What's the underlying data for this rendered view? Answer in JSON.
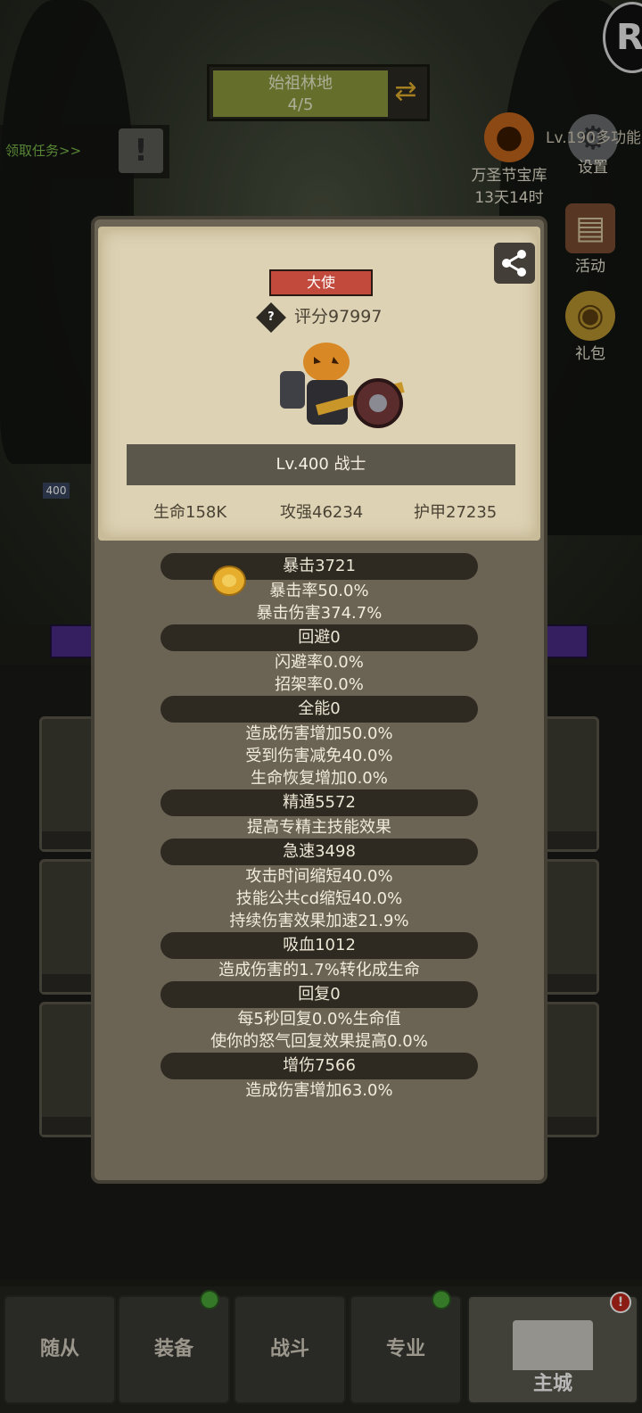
{
  "map": {
    "name": "始祖林地",
    "progress": "4/5"
  },
  "quest": {
    "label": "领取任务>>",
    "alert_glyph": "!"
  },
  "corner_logo": {
    "glyph": "R"
  },
  "side_buttons": {
    "treasure": {
      "label": "万圣节宝库",
      "time": "13天14时",
      "icon": "pumpkin-icon"
    },
    "settings": {
      "label": "Lv.190多功能",
      "sub": "设置",
      "icon": "gear-icon"
    },
    "activity": {
      "label": "活动",
      "icon": "scroll-icon"
    },
    "gift": {
      "label": "礼包",
      "icon": "gift-bag-icon"
    }
  },
  "level_chip": "400",
  "hero": {
    "title": "大使",
    "score": "评分97997",
    "name": "Lv.400 战士",
    "life": "生命158K",
    "attack": "攻强46234",
    "armor": "护甲27235"
  },
  "stat_groups": [
    {
      "head": "暴击3721",
      "lines": [
        "暴击率50.0%",
        "暴击伤害374.7%"
      ]
    },
    {
      "head": "回避0",
      "lines": [
        "闪避率0.0%",
        "招架率0.0%"
      ]
    },
    {
      "head": "全能0",
      "lines": [
        "造成伤害增加50.0%",
        "受到伤害减免40.0%",
        "生命恢复增加0.0%"
      ]
    },
    {
      "head": "精通5572",
      "lines": [
        "提高专精主技能效果"
      ]
    },
    {
      "head": "急速3498",
      "lines": [
        "攻击时间缩短40.0%",
        "技能公共cd缩短40.0%",
        "持续伤害效果加速21.9%"
      ]
    },
    {
      "head": "吸血1012",
      "lines": [
        "造成伤害的1.7%转化成生命"
      ]
    },
    {
      "head": "回复0",
      "lines": [
        "每5秒回复0.0%生命值",
        "使你的怒气回复效果提高0.0%"
      ]
    },
    {
      "head": "增伤7566",
      "lines": [
        "造成伤害增加63.0%"
      ]
    }
  ],
  "bottom_nav": [
    {
      "label": "随从",
      "badge": ""
    },
    {
      "label": "装备",
      "badge": "green"
    },
    {
      "label": "战斗",
      "badge": ""
    },
    {
      "label": "专业",
      "badge": "green"
    },
    {
      "label": "主城",
      "badge": "red"
    }
  ],
  "colors": {
    "accent_red": "#c24a3c",
    "stat_pill": "#2e2a22",
    "card_bg": "#ddd3b4"
  }
}
